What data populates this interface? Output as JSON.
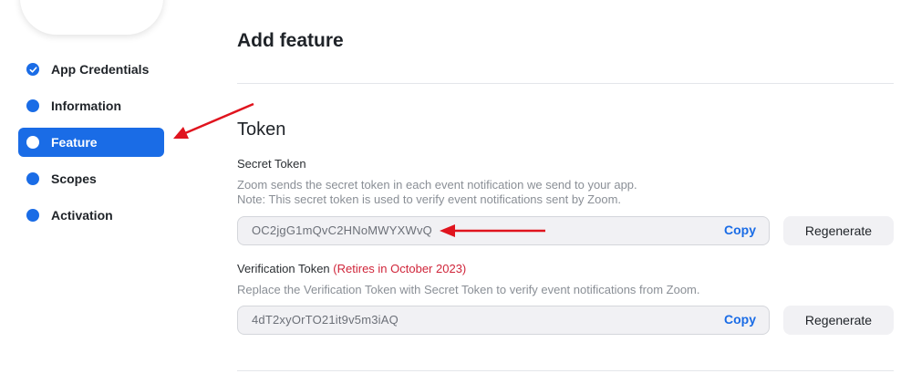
{
  "sidebar": {
    "items": [
      {
        "label": "App Credentials",
        "state": "completed"
      },
      {
        "label": "Information",
        "state": "default"
      },
      {
        "label": "Feature",
        "state": "active"
      },
      {
        "label": "Scopes",
        "state": "default"
      },
      {
        "label": "Activation",
        "state": "default"
      }
    ]
  },
  "main": {
    "page_title": "Add feature",
    "section_title": "Token",
    "secret_token": {
      "label": "Secret Token",
      "description_line1": "Zoom sends the secret token in each event notification we send to your app.",
      "description_line2": "Note: This secret token is used to verify event notifications sent by Zoom.",
      "value": "OC2jgG1mQvC2HNoMWYXWvQ",
      "copy_label": "Copy",
      "regenerate_label": "Regenerate"
    },
    "verification_token": {
      "label": "Verification Token",
      "retire_note": "(Retires in October 2023)",
      "description": "Replace the Verification Token with Secret Token to verify event notifications from Zoom.",
      "value": "4dT2xyOrTO21it9v5m3iAQ",
      "copy_label": "Copy",
      "regenerate_label": "Regenerate"
    }
  },
  "colors": {
    "accent": "#1a6ce6",
    "warning": "#d0253a",
    "annotation_arrow": "#e0141e"
  },
  "icons": {
    "completed_step": "check-icon",
    "annotation": "red-arrow-icon"
  }
}
